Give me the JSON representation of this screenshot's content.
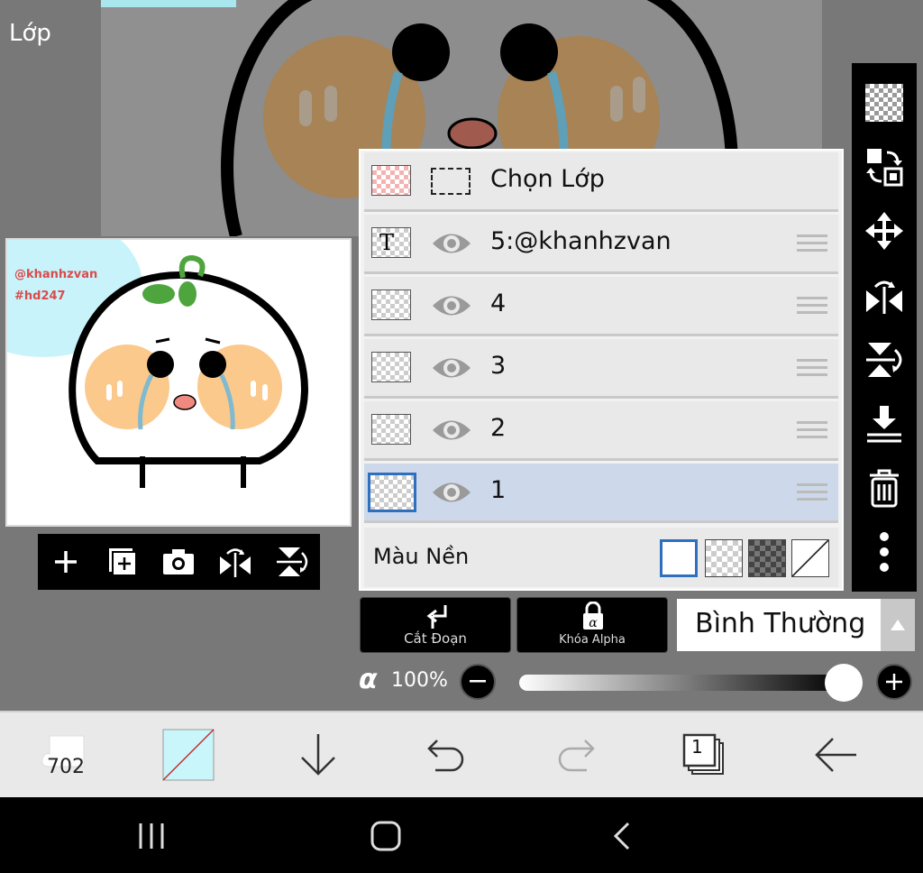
{
  "panel": {
    "title": "Lớp"
  },
  "thumbnail": {
    "watermark_line1": "@khanhzvan",
    "watermark_line2": "#hd247"
  },
  "layers": {
    "select_layer_label": "Chọn Lớp",
    "items": [
      {
        "name": "5:@khanhzvan",
        "kind": "text",
        "visible": true,
        "selected": false
      },
      {
        "name": "4",
        "kind": "raster",
        "visible": true,
        "selected": false
      },
      {
        "name": "3",
        "kind": "raster",
        "visible": true,
        "selected": false
      },
      {
        "name": "2",
        "kind": "raster",
        "visible": true,
        "selected": false
      },
      {
        "name": "1",
        "kind": "raster",
        "visible": true,
        "selected": true
      }
    ],
    "background_label": "Màu Nền",
    "text_layer_glyph": "T"
  },
  "controls": {
    "clipping_label": "Cắt Đoạn",
    "alpha_lock_label": "Khóa Alpha",
    "blend_mode": "Bình Thường",
    "opacity_symbol": "α",
    "opacity_text": "100%",
    "opacity_value": 100
  },
  "app_bar": {
    "brush_size": "702",
    "layer_count": "1"
  },
  "colors": {
    "accent": "#2f6fbf",
    "selected_row": "#cdd9ea",
    "current_color": "#c8f6fb"
  }
}
